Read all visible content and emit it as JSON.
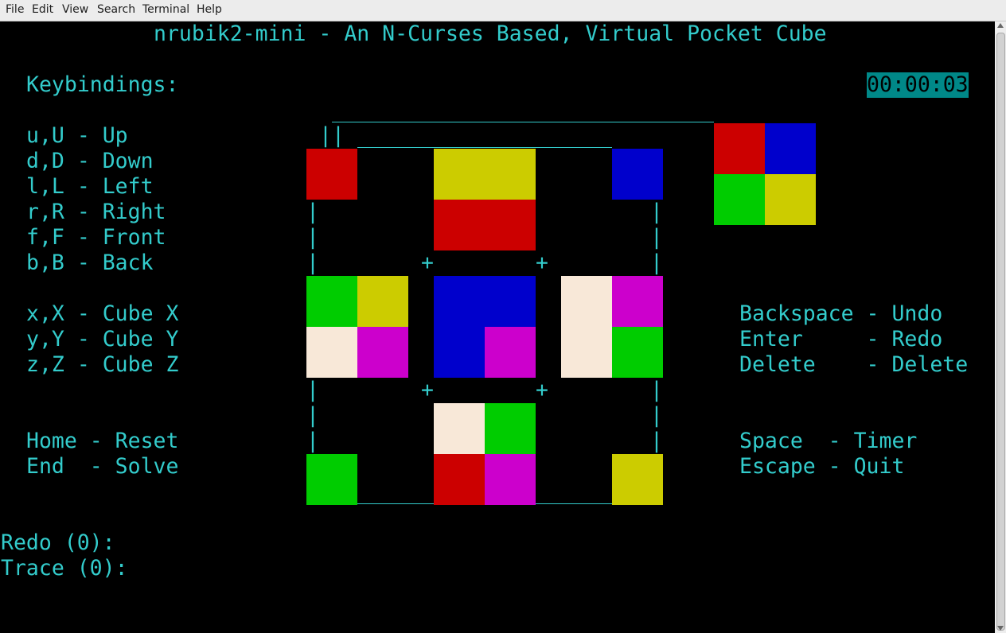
{
  "menu": {
    "file": "File",
    "edit": "Edit",
    "view": "View",
    "search": "Search",
    "terminal": "Terminal",
    "help": "Help"
  },
  "title": "nrubik2-mini - An N-Curses Based, Virtual Pocket Cube",
  "timer": "00:00:03",
  "keybindings": {
    "header": "Keybindings:",
    "up": "u,U - Up",
    "down": "d,D - Down",
    "left": "l,L - Left",
    "right": "r,R - Right",
    "front": "f,F - Front",
    "back": "b,B - Back",
    "cube_x": "x,X - Cube X",
    "cube_y": "y,Y - Cube Y",
    "cube_z": "z,Z - Cube Z",
    "reset": "Home - Reset",
    "solve": "End  - Solve"
  },
  "right_keys": {
    "undo": "Backspace - Undo",
    "redo": "Enter     - Redo",
    "delete": "Delete    - Delete",
    "timer": "Space  - Timer",
    "quit": "Escape - Quit"
  },
  "status": {
    "redo": "Redo (0):",
    "trace": "Trace (0):"
  },
  "glyphs": {
    "double_bar": "||",
    "bar": "|",
    "plus": "+"
  },
  "colors": {
    "fg": "#33cccc",
    "bg": "#000000",
    "red": "#cc0000",
    "blue": "#0000cc",
    "green": "#00cc00",
    "yellow": "#cccc00",
    "white": "#f8e8d8",
    "magenta": "#cc00cc"
  },
  "cube": {
    "back_tl": "red",
    "back_tr": "blue",
    "back_bl": "green",
    "back_br": "yellow",
    "up_back_left": "red",
    "up_mid_1": "yellow",
    "up_mid_2": "yellow",
    "up_back_right": "blue",
    "up_front_1": "red",
    "up_front_2": "red",
    "left_tl": "green",
    "left_tr": "yellow",
    "left_bl": "white",
    "left_br": "magenta",
    "front_tl": "blue",
    "front_tr": "blue",
    "front_bl": "blue",
    "front_br": "magenta",
    "right_tl": "white",
    "right_tr": "magenta",
    "right_bl": "white",
    "right_br": "green",
    "down_front_1": "white",
    "down_front_2": "green",
    "down_back_left": "green",
    "down_mid_1": "red",
    "down_mid_2": "magenta",
    "down_back_right": "yellow"
  }
}
